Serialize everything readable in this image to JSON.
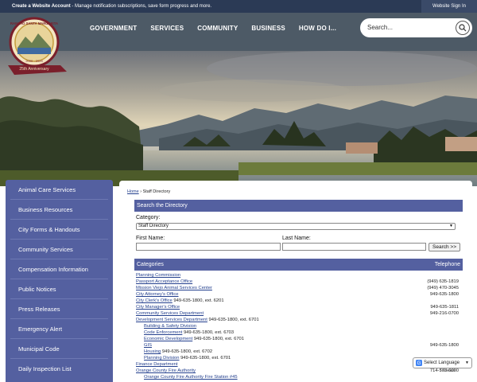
{
  "topbar": {
    "account_bold": "Create a Website Account",
    "account_rest": " - Manage notification subscriptions, save form progress and more.",
    "signin": "Website Sign In"
  },
  "nav": {
    "items": [
      "GOVERNMENT",
      "SERVICES",
      "COMMUNITY",
      "BUSINESS",
      "HOW DO I..."
    ]
  },
  "search": {
    "placeholder": "Search...",
    "icon": "magnifier"
  },
  "logo": {
    "text_top": "RANCHO SANTA MARGARITA",
    "text_banner": "25th Anniversary",
    "text_years": "2000 - 2025"
  },
  "sidebar": {
    "items": [
      "Animal Care Services",
      "Business Resources",
      "City Forms & Handouts",
      "Community Services",
      "Compensation Information",
      "Public Notices",
      "Press Releases",
      "Emergency Alert",
      "Municipal Code",
      "Daily Inspection List"
    ]
  },
  "breadcrumb": {
    "home": "Home",
    "sep": " › ",
    "current": "Staff Directory"
  },
  "search_directory": {
    "title": "Search the Directory",
    "category_label": "Category:",
    "category_value": "Staff Directory",
    "first_name_label": "First Name:",
    "last_name_label": "Last Name:",
    "button": "Search >>"
  },
  "table": {
    "col_categories": "Categories",
    "col_telephone": "Telephone",
    "rows": [
      {
        "name": "Planning Commission",
        "ext": "",
        "tel": "",
        "indent": false
      },
      {
        "name": "Passport Acceptance Office",
        "ext": "",
        "tel": "(949) 635-1819",
        "indent": false
      },
      {
        "name": "Mission Viejo Animal Services Center",
        "ext": "",
        "tel": "(949) 470-3045",
        "indent": false
      },
      {
        "name": "City Attorney's Office",
        "ext": "",
        "tel": "949-635-1800",
        "indent": false
      },
      {
        "name": "City Clerk's Office",
        "ext": " 949-635-1800, ext. 6201",
        "tel": "",
        "indent": false
      },
      {
        "name": "City Manager's Office",
        "ext": "",
        "tel": "949-635-1811",
        "indent": false
      },
      {
        "name": "Community Services Department",
        "ext": "",
        "tel": "949-216-0700",
        "indent": false
      },
      {
        "name": "Development Services Department",
        "ext": " 949-635-1800, ext. 6701",
        "tel": "",
        "indent": false
      },
      {
        "name": "Building & Safety Division",
        "ext": "",
        "tel": "",
        "indent": true
      },
      {
        "name": "Code Enforcement",
        "ext": " 949-635-1800, ext. 6703",
        "tel": "",
        "indent": true
      },
      {
        "name": "Economic Development",
        "ext": " 949-635-1800, ext. 6701",
        "tel": "",
        "indent": true
      },
      {
        "name": "GIS",
        "ext": "",
        "tel": "949-635-1800",
        "indent": true
      },
      {
        "name": "Housing",
        "ext": " 949-635-1800, ext. 6702",
        "tel": "",
        "indent": true
      },
      {
        "name": "Planning Division",
        "ext": " 949-635-1800, ext. 6701",
        "tel": "",
        "indent": true
      },
      {
        "name": "Finance Department",
        "ext": "",
        "tel": "",
        "indent": false
      },
      {
        "name": "Orange County Fire Authority",
        "ext": "",
        "tel": "714-573-6000",
        "indent": false
      },
      {
        "name": "Orange County Fire Authority Fire Station #45",
        "ext": "",
        "tel": "",
        "indent": true
      }
    ]
  },
  "translate": {
    "label": "Select Language",
    "powered": "Translate"
  },
  "colors": {
    "nav_bg": "#4d5a66",
    "accent": "#5460a0",
    "topbar": "#2b3a55",
    "link": "#24408e"
  }
}
